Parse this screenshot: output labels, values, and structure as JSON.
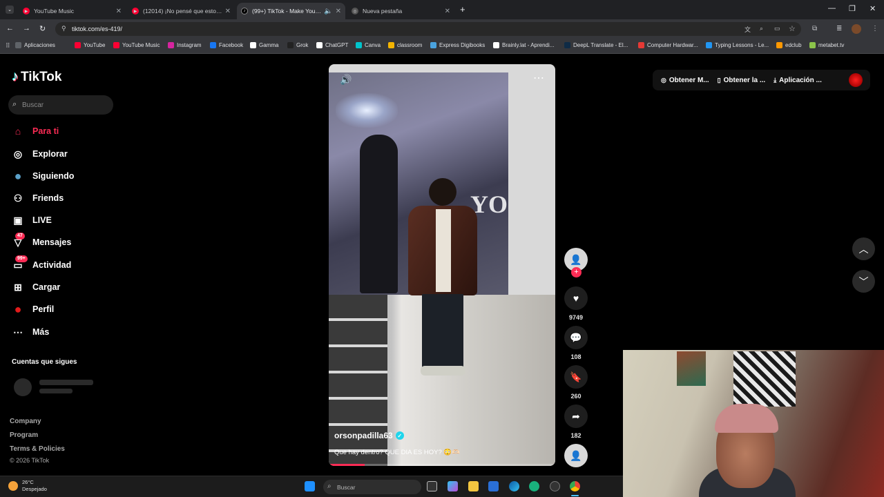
{
  "browser": {
    "tabs": [
      {
        "label": "YouTube Music",
        "fav_color": "#ff0033",
        "active": false
      },
      {
        "label": "(12014) ¡No pensé que esto pa",
        "fav_color": "#ff0033",
        "active": false
      },
      {
        "label": "(99+) TikTok - Make Your D",
        "fav_color": "#000000",
        "active": true
      },
      {
        "label": "Nueva pestaña",
        "fav_color": "#7a7a7a",
        "active": false
      }
    ],
    "url": "tiktok.com/es-419/",
    "bookmarks": [
      {
        "label": "Aplicaciones",
        "color": "#5f6368"
      },
      {
        "label": "YouTube",
        "color": "#ff0033"
      },
      {
        "label": "YouTube Music",
        "color": "#ff0033"
      },
      {
        "label": "Instagram",
        "color": "#d6249f"
      },
      {
        "label": "Facebook",
        "color": "#1877f2"
      },
      {
        "label": "Gamma",
        "color": "#ffffff"
      },
      {
        "label": "Grok",
        "color": "#222222"
      },
      {
        "label": "ChatGPT",
        "color": "#ffffff"
      },
      {
        "label": "Canva",
        "color": "#00c4cc"
      },
      {
        "label": "classroom",
        "color": "#f4b400"
      },
      {
        "label": "Express Digibooks",
        "color": "#4aa3df"
      },
      {
        "label": "Brainly.lat - Aprendi...",
        "color": "#ffffff"
      },
      {
        "label": "DeepL Translate - El...",
        "color": "#0f2b46"
      },
      {
        "label": "Computer Hardwar...",
        "color": "#e53935"
      },
      {
        "label": "Typing Lessons - Le...",
        "color": "#2196f3"
      },
      {
        "label": "edclub",
        "color": "#ff9800"
      },
      {
        "label": "metabet.tv",
        "color": "#8bc34a"
      }
    ]
  },
  "tiktok": {
    "logo_text": "TikTok",
    "search_placeholder": "Buscar",
    "nav": [
      {
        "label": "Para ti",
        "icon": "home-icon",
        "active": true
      },
      {
        "label": "Explorar",
        "icon": "compass-icon",
        "active": false
      },
      {
        "label": "Siguiendo",
        "icon": "following-avatar-icon",
        "active": false
      },
      {
        "label": "Friends",
        "icon": "friends-icon",
        "active": false
      },
      {
        "label": "LIVE",
        "icon": "live-icon",
        "active": false
      },
      {
        "label": "Mensajes",
        "icon": "messages-icon",
        "active": false,
        "badge": "47"
      },
      {
        "label": "Actividad",
        "icon": "activity-icon",
        "active": false,
        "badge": "99+"
      },
      {
        "label": "Cargar",
        "icon": "upload-icon",
        "active": false
      },
      {
        "label": "Perfil",
        "icon": "profile-avatar-icon",
        "active": false
      },
      {
        "label": "Más",
        "icon": "more-icon",
        "active": false
      }
    ],
    "following_header": "Cuentas que sigues",
    "footer": {
      "links": [
        "Company",
        "Program",
        "Terms & Policies"
      ],
      "copyright": "© 2026 TikTok"
    },
    "video": {
      "username": "orsonpadilla63",
      "verified": true,
      "caption": "Que hay dentro? QUE DIA ES HOY? 😳🫶🏻",
      "overlay_text": "YO",
      "progress": 0.16
    },
    "actions": {
      "likes": "9749",
      "comments": "108",
      "saves": "260",
      "shares": "182"
    },
    "header_buttons": [
      "Obtener M...",
      "Obtener la ...",
      "Aplicación ..."
    ],
    "accent": "#fe2c55"
  },
  "taskbar": {
    "weather_temp": "26°C",
    "weather_desc": "Despejado",
    "search_placeholder": "Buscar"
  }
}
